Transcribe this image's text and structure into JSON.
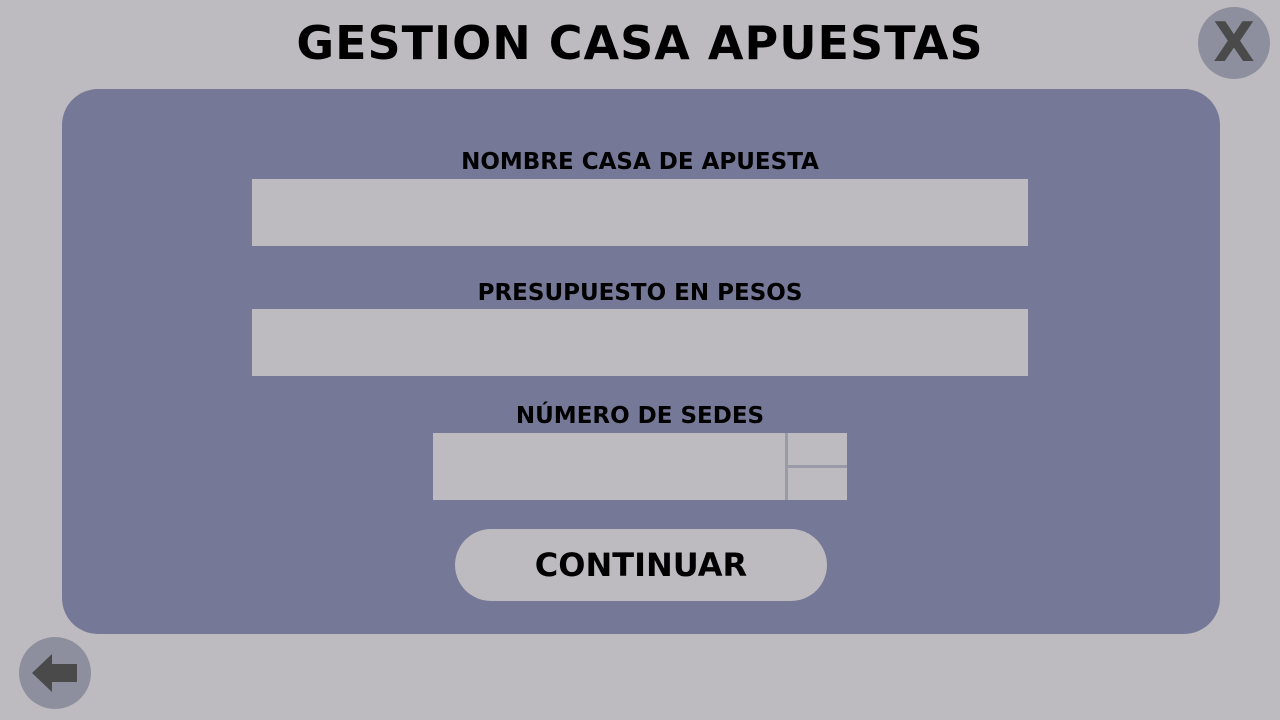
{
  "title": "GESTION CASA APUESTAS",
  "close_button": {
    "label": "X"
  },
  "form": {
    "name_field": {
      "label": "NOMBRE CASA DE APUESTA",
      "value": "",
      "placeholder": ""
    },
    "budget_field": {
      "label": "PRESUPUESTO EN PESOS",
      "value": "",
      "placeholder": ""
    },
    "branches_field": {
      "label": "NÚMERO DE SEDES",
      "value": "",
      "placeholder": ""
    }
  },
  "continue_button": {
    "label": "CONTINUAR"
  },
  "icons": {
    "close": "close-icon",
    "back": "arrow-left-icon"
  },
  "colors": {
    "background": "#bdbbbf",
    "panel": "#757896",
    "round_button": "#8e8f9e",
    "icon": "#4a4a4a"
  }
}
